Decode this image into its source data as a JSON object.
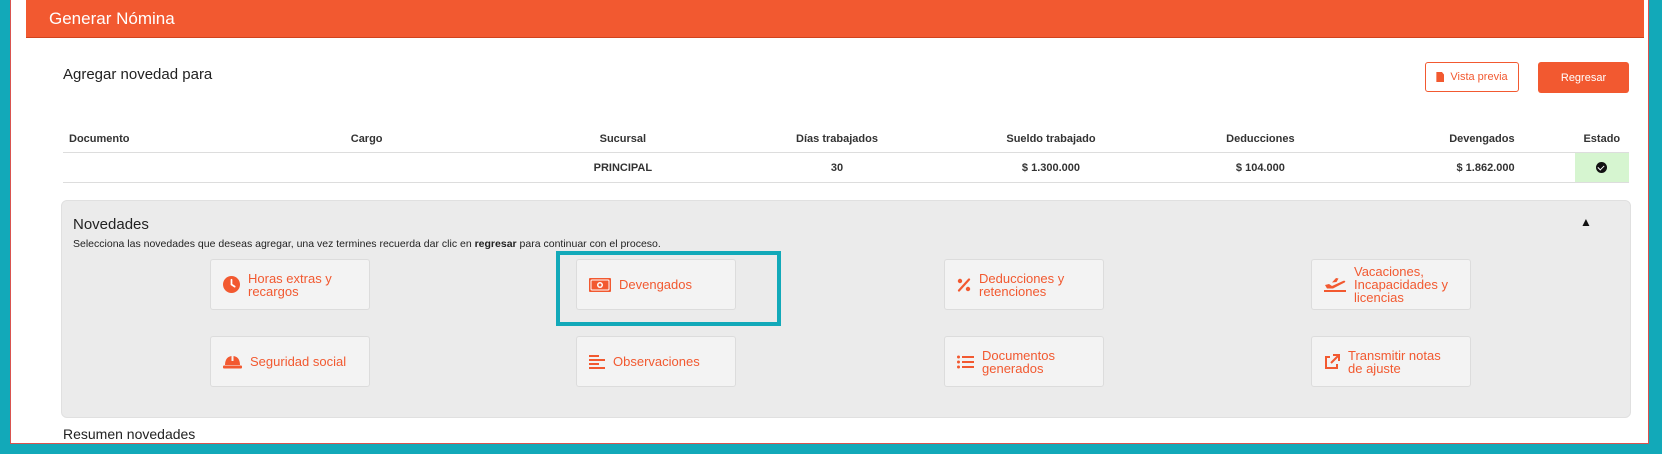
{
  "header": {
    "title": "Generar Nómina"
  },
  "page": {
    "heading": "Agregar novedad para"
  },
  "toolbar": {
    "preview_label": "Vista previa",
    "back_label": "Regresar"
  },
  "table": {
    "columns": [
      "Documento",
      "Cargo",
      "Sucursal",
      "Días trabajados",
      "Sueldo trabajado",
      "Deducciones",
      "Devengados",
      "Estado"
    ],
    "rows": [
      {
        "documento": "",
        "cargo": "",
        "sucursal": "PRINCIPAL",
        "dias": "30",
        "sueldo": "$ 1.300.000",
        "deducciones": "$ 104.000",
        "devengados": "$ 1.862.000",
        "estado": "check-circle-icon"
      }
    ]
  },
  "novedades": {
    "title": "Novedades",
    "desc_before": "Selecciona las novedades que deseas agregar, una vez termines recuerda dar clic en ",
    "desc_bold": "regresar",
    "desc_after": " para continuar con el proceso.",
    "collapse_glyph": "▲",
    "tiles": [
      {
        "label_1": "Horas extras y",
        "label_2": "recargos",
        "icon": "clock-icon"
      },
      {
        "label_1": "Devengados",
        "label_2": "",
        "icon": "money-bill-icon"
      },
      {
        "label_1": "Deducciones y",
        "label_2": "retenciones",
        "icon": "percent-icon"
      },
      {
        "label_1": "Vacaciones,",
        "label_2": "Incapacidades y",
        "label_3": "licencias",
        "icon": "plane-departure-icon"
      },
      {
        "label_1": "Seguridad social",
        "label_2": "",
        "icon": "hard-hat-icon"
      },
      {
        "label_1": "Observaciones",
        "label_2": "",
        "icon": "align-left-icon"
      },
      {
        "label_1": "Documentos",
        "label_2": "generados",
        "icon": "list-icon"
      },
      {
        "label_1": "Transmitir notas",
        "label_2": "de ajuste",
        "icon": "external-link-icon"
      }
    ]
  },
  "resumen": {
    "title": "Resumen novedades"
  },
  "colors": {
    "brand": "#f25930",
    "highlight": "#12a9b9",
    "status_ok": "#d6f5d0"
  }
}
